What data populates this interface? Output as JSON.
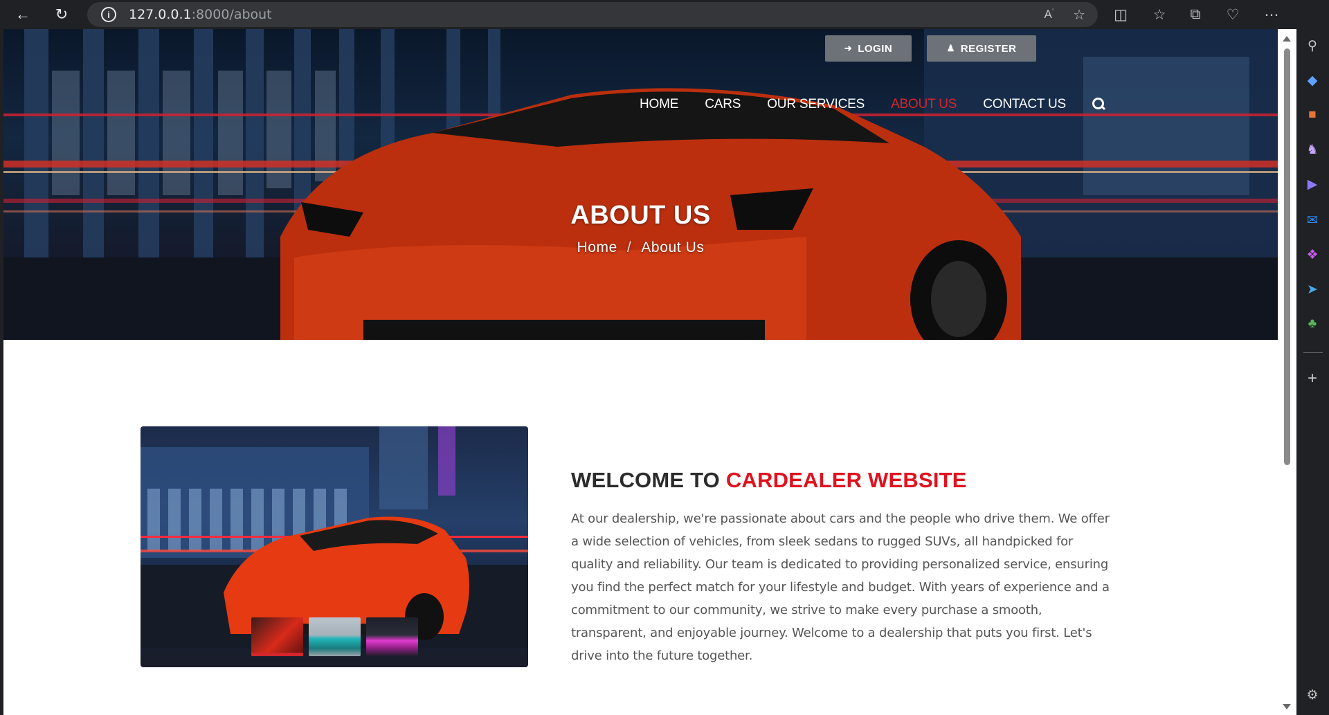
{
  "browser": {
    "url_host": "127.0.0.1",
    "url_path": ":8000/about",
    "icons": [
      "back-icon",
      "refresh-icon",
      "info-icon",
      "read-aloud-icon",
      "favorite-icon",
      "split-screen-icon",
      "favorites-icon",
      "collections-icon",
      "performance-icon",
      "more-icon",
      "copilot-icon"
    ]
  },
  "sidebar": {
    "icons": [
      "search-icon",
      "shopping-icon",
      "tools-icon",
      "games-icon",
      "copilot-icon",
      "outlook-icon",
      "office-icon",
      "telegram-icon",
      "tree-icon",
      "add-icon",
      "settings-icon"
    ]
  },
  "header": {
    "login_label": "LOGIN",
    "register_label": "REGISTER",
    "nav": [
      {
        "label": "HOME"
      },
      {
        "label": "CARS"
      },
      {
        "label": "OUR SERVICES"
      },
      {
        "label": "ABOUT US"
      },
      {
        "label": "CONTACT US"
      }
    ],
    "active_nav": "ABOUT US"
  },
  "hero": {
    "title": "ABOUT US",
    "breadcrumb_home": "Home",
    "breadcrumb_sep": "/",
    "breadcrumb_current": "About Us"
  },
  "about": {
    "heading_prefix": "WELCOME TO",
    "heading_accent": "CARDEALER WEBSITE",
    "text": "At our dealership, we're passionate about cars and the people who drive them. We offer a wide selection of vehicles, from sleek sedans to rugged SUVs, all handpicked for quality and reliability. Our team is dedicated to providing personalized service, ensuring you find the perfect match for your lifestyle and budget. With years of experience and a commitment to our community, we strive to make every purchase a smooth, transparent, and enjoyable journey. Welcome to a dealership that puts you first. Let's drive into the future together.",
    "thumbnails": [
      "red car",
      "teal car",
      "pink car"
    ]
  },
  "colors": {
    "accent": "#e0121f",
    "nav_active": "#d4262c",
    "auth_button": "#6d7278"
  }
}
